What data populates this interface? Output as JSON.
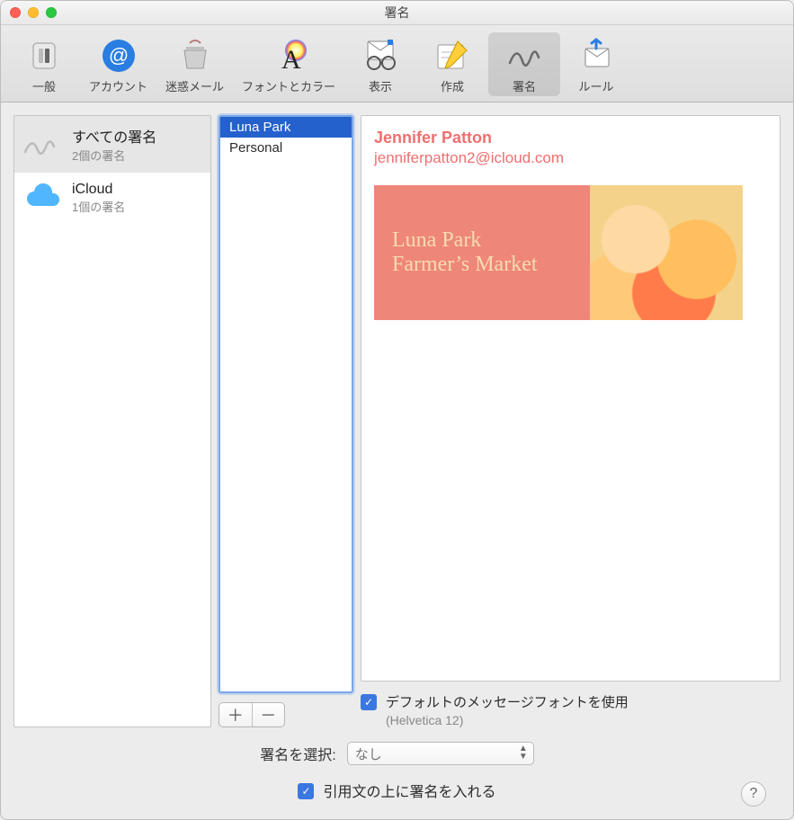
{
  "window": {
    "title": "署名"
  },
  "toolbar": {
    "items": [
      {
        "label": "一般"
      },
      {
        "label": "アカウント"
      },
      {
        "label": "迷惑メール"
      },
      {
        "label": "フォントとカラー"
      },
      {
        "label": "表示"
      },
      {
        "label": "作成"
      },
      {
        "label": "署名"
      },
      {
        "label": "ルール"
      }
    ],
    "selected_index": 6
  },
  "accounts": {
    "items": [
      {
        "name": "すべての署名",
        "sub": "2個の署名"
      },
      {
        "name": "iCloud",
        "sub": "1個の署名"
      }
    ],
    "selected_index": 0
  },
  "signatures": {
    "items": [
      {
        "name": "Luna Park"
      },
      {
        "name": "Personal"
      }
    ],
    "selected_index": 0
  },
  "add_remove": {
    "add": "＋",
    "remove": "－"
  },
  "preview": {
    "name": "Jennifer Patton",
    "email": "jenniferpatton2@icloud.com",
    "banner_line1": "Luna Park",
    "banner_line2": "Farmer’s Market"
  },
  "options": {
    "use_default_font_label": "デフォルトのメッセージフォントを使用",
    "use_default_font_checked": true,
    "default_font_note": "(Helvetica 12)",
    "choose_label": "署名を選択:",
    "choose_value": "なし",
    "above_quote_label": "引用文の上に署名を入れる",
    "above_quote_checked": true
  },
  "help": {
    "label": "?"
  }
}
